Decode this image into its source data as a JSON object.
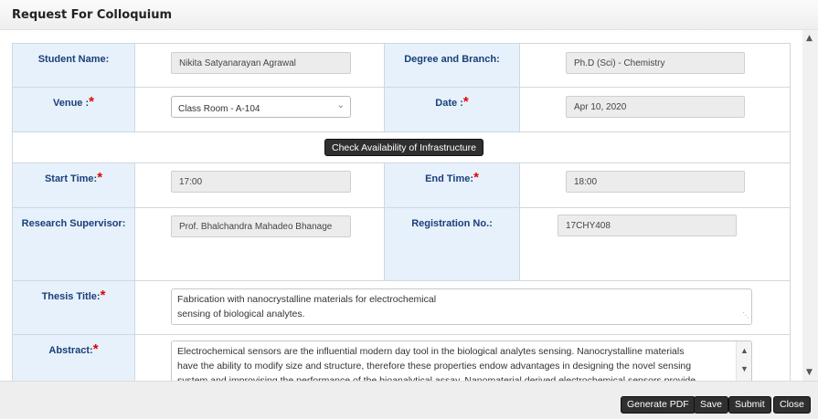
{
  "window": {
    "title": "Request For Colloquium"
  },
  "form": {
    "student_name": {
      "label": "Student Name:",
      "value": "Nikita Satyanarayan Agrawal"
    },
    "degree": {
      "label": "Degree and Branch:",
      "value": "Ph.D (Sci) - Chemistry"
    },
    "venue": {
      "label": "Venue :",
      "value": "Class Room - A-104"
    },
    "date": {
      "label": "Date :",
      "value": "Apr 10, 2020"
    },
    "check_button": "Check Availability of Infrastructure",
    "start_time": {
      "label": "Start Time:",
      "value": "17:00"
    },
    "end_time": {
      "label": "End Time:",
      "value": "18:00"
    },
    "supervisor": {
      "label": "Research Supervisor:",
      "value": "Prof. Bhalchandra Mahadeo Bhanage"
    },
    "registration": {
      "label": "Registration No.:",
      "value": "17CHY408"
    },
    "thesis_title": {
      "label": "Thesis Title:",
      "line1": "Fabrication with nanocrystalline materials for electrochemical",
      "line2": "sensing of biological analytes."
    },
    "abstract": {
      "label": "Abstract:",
      "line1": "Electrochemical sensors are the influential modern day tool in the biological analytes sensing. Nanocrystalline materials",
      "line2": "have the ability to modify size and structure, therefore these properties endow advantages in designing the novel sensing",
      "line3": "system and improvising the performance of the bioanalytical assay. Nanomaterial derived electrochemical sensors provide"
    },
    "required_mark": "*"
  },
  "footer": {
    "generate_pdf": "Generate PDF",
    "save": "Save",
    "submit": "Submit",
    "close": "Close"
  }
}
